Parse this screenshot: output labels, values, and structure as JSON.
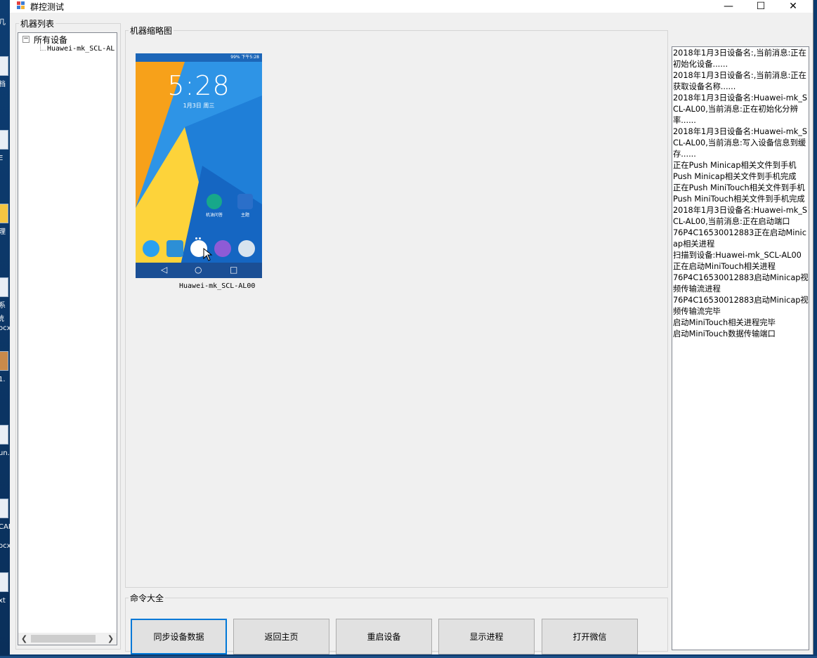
{
  "window": {
    "title": "群控测试",
    "controls": {
      "minimize": "—",
      "maximize": "☐",
      "close": "✕"
    }
  },
  "device_list": {
    "group_label": "机器列表",
    "root": {
      "toggle": "−",
      "label": "所有设备"
    },
    "children": [
      "Huawei-mk_SCL-AL"
    ]
  },
  "thumbnails": {
    "group_label": "机器缩略图",
    "items": [
      {
        "device_name": "Huawei-mk_SCL-AL00",
        "screen": {
          "status_text": "99%  下午5:28",
          "clock": "5:28",
          "date": "1月3日 周三",
          "apps": [
            {
              "label": "机油问答",
              "icon": "question-icon"
            },
            {
              "label": "主题",
              "icon": "theme-icon"
            }
          ],
          "nav": [
            "◁",
            "○",
            "□"
          ]
        }
      }
    ]
  },
  "commands": {
    "group_label": "命令大全",
    "buttons": [
      {
        "label": "同步设备数据",
        "active": true
      },
      {
        "label": "返回主页",
        "active": false
      },
      {
        "label": "重启设备",
        "active": false
      },
      {
        "label": "显示进程",
        "active": false
      },
      {
        "label": "打开微信",
        "active": false
      }
    ]
  },
  "log": {
    "lines": [
      "2018年1月3日设备名:,当前消息:正在初始化设备......",
      "2018年1月3日设备名:,当前消息:正在获取设备名称......",
      "2018年1月3日设备名:Huawei-mk_SCL-AL00,当前消息:正在初始化分辨率......",
      "2018年1月3日设备名:Huawei-mk_SCL-AL00,当前消息:写入设备信息到缓存......",
      "正在Push Minicap相关文件到手机",
      "Push Minicap相关文件到手机完成",
      "正在Push MiniTouch相关文件到手机",
      "Push MiniTouch相关文件到手机完成",
      "2018年1月3日设备名:Huawei-mk_SCL-AL00,当前消息:正在启动端口",
      "76P4C16530012883正在启动Minicap相关进程",
      "扫描到设备:Huawei-mk_SCL-AL00",
      "正在启动MiniTouch相关进程",
      "76P4C16530012883启动Minicap视频传输流进程",
      "76P4C16530012883启动Minicap视频传输流完毕",
      "启动MiniTouch相关进程完毕",
      "启动MiniTouch数据传输端口"
    ]
  },
  "desktop": {
    "labels": [
      "几",
      "档",
      "E",
      "理",
      "系统",
      "ocx",
      "1.",
      "un.",
      "CAP",
      "ocx",
      "xt"
    ]
  }
}
